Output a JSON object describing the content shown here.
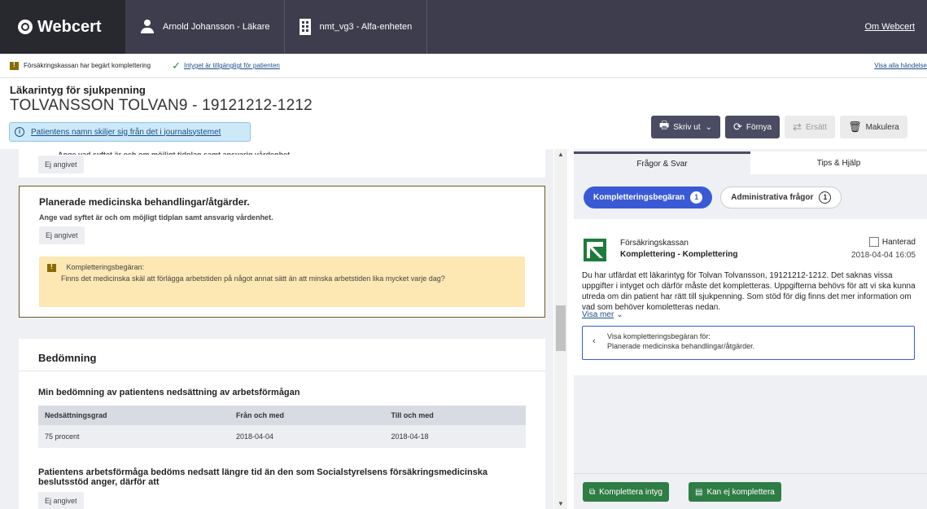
{
  "header": {
    "brand": "Webcert",
    "user": "Arnold Johansson - Läkare",
    "unit": "nmt_vg3 - Alfa-enheten",
    "about_link": "Om Webcert"
  },
  "events": {
    "completion_requested": "Försäkringskassan har begärt komplettering",
    "available_to_patient": "Intyget är tillgängligt för patienten",
    "show_all": "Visa alla händelse"
  },
  "document": {
    "type": "Läkarintyg för sjukpenning",
    "patient": "TOLVANSSON TOLVAN9 - 19121212-1212",
    "name_banner": "Patientens namn skiljer sig från det i journalsystemet"
  },
  "actions": {
    "print": "Skriv ut",
    "renew": "Förnya",
    "replace": "Ersätt",
    "revoke": "Makulera"
  },
  "form": {
    "cut_text": "Ange vad syftet är och om möjligt tidplan samt ansvarig vårdenhet.",
    "not_given_1": "Ej angivet",
    "planned_title": "Planerade medicinska behandlingar/åtgärder.",
    "planned_sub": "Ange vad syftet är och om möjligt tidplan samt ansvarig vårdenhet.",
    "not_given_2": "Ej angivet",
    "warning_title": "Kompletteringsbegäran:",
    "warning_text": "Finns det medicinska skäl att förlägga arbetstiden på något annat sätt än att minska arbetstiden lika mycket varje dag?",
    "assessment_title": "Bedömning",
    "assessment_sub": "Min bedömning av patientens nedsättning av arbetsförmågan",
    "table_headers": [
      "Nedsättningsgrad",
      "Från och med",
      "Till och med"
    ],
    "table_rows": [
      [
        "75 procent",
        "2018-04-04",
        "2018-04-18"
      ]
    ],
    "longer_title": "Patientens arbetsförmåga bedöms nedsatt längre tid än den som Socialstyrelsens försäkringsmedicinska beslutsstöd anger, därför att",
    "not_given_3": "Ej angivet"
  },
  "panel": {
    "tab_qa": "Frågor & Svar",
    "tab_tips": "Tips & Hjälp",
    "pill_completion": "Kompletteringsbegäran",
    "pill_completion_count": "1",
    "pill_admin": "Administrativa frågor",
    "pill_admin_count": "1",
    "sender": "Försäkringskassan",
    "question_type": "Komplettering - Komplettering",
    "handled_label": "Hanterad",
    "date": "2018-04-04 16:05",
    "message": "Du har utfärdat ett läkarintyg för Tolvan Tolvansson, 19121212-1212. Det saknas vissa uppgifter i intyget och därför måste det kompletteras. Uppgifterna behövs för att vi ska kunna utreda om din patient har rätt till sjukpenning. Som stöd för dig finns det mer information om vad som behöver kompletteras nedan.",
    "show_more": "Visa mer",
    "show_request_for": "Visa kompletteringsbegäran för:",
    "show_request_target": "Planerade medicinska behandlingar/åtgärder.",
    "complete_button": "Komplettera intyg",
    "cannot_complete_button": "Kan ej komplettera"
  }
}
